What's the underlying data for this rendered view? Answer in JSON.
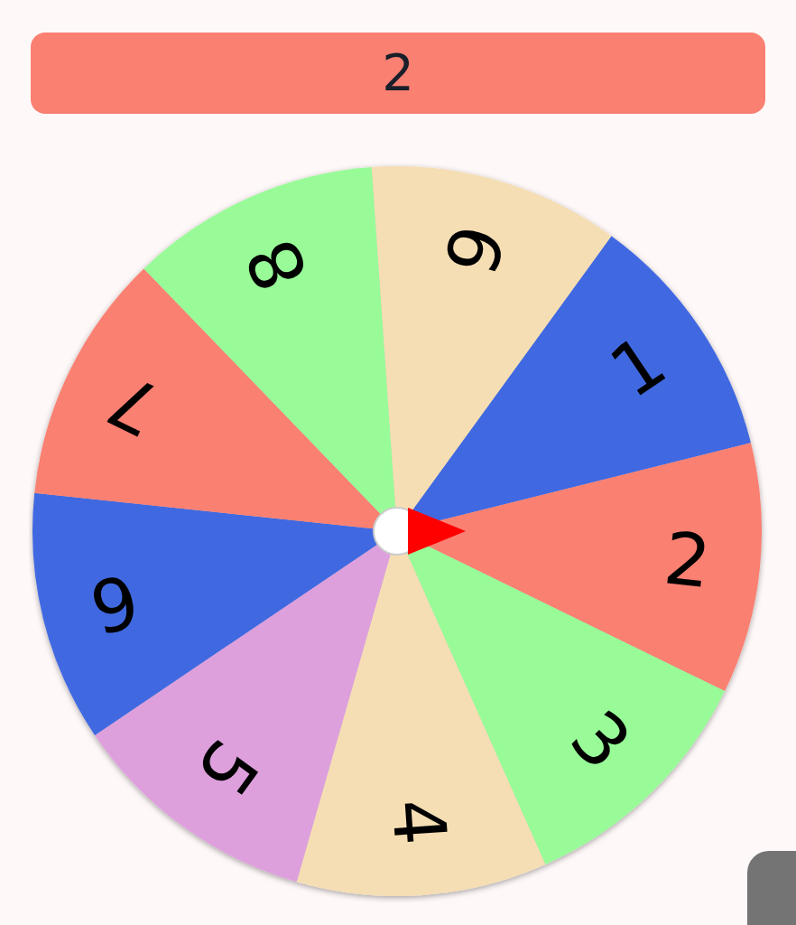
{
  "result": {
    "label": "2",
    "color": "#fa8072"
  },
  "wheel": {
    "segments": [
      {
        "label": "1",
        "color": "#4169e1"
      },
      {
        "label": "2",
        "color": "#fa8072"
      },
      {
        "label": "3",
        "color": "#98fb98"
      },
      {
        "label": "4",
        "color": "#f5deb3"
      },
      {
        "label": "5",
        "color": "#dda0dd"
      },
      {
        "label": "6",
        "color": "#4169e1"
      },
      {
        "label": "7",
        "color": "#fa8072"
      },
      {
        "label": "8",
        "color": "#98fb98"
      },
      {
        "label": "9",
        "color": "#f5deb3"
      }
    ]
  }
}
